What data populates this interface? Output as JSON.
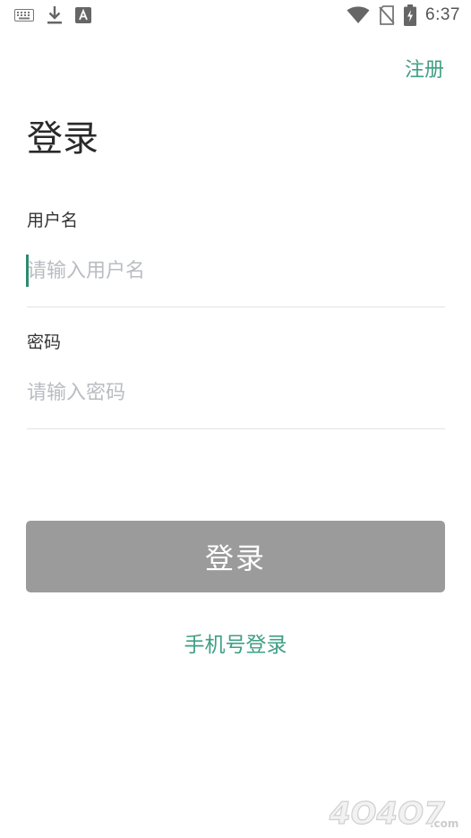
{
  "status_bar": {
    "time": "6:37",
    "left_icons": [
      "keyboard-icon",
      "download-icon",
      "text-a-icon"
    ],
    "right_icons": [
      "wifi-icon",
      "no-sim-icon",
      "battery-charging-icon"
    ]
  },
  "header": {
    "register_label": "注册"
  },
  "title": "登录",
  "username": {
    "label": "用户名",
    "placeholder": "请输入用户名",
    "value": ""
  },
  "password": {
    "label": "密码",
    "placeholder": "请输入密码",
    "value": ""
  },
  "login_button_label": "登录",
  "phone_login_label": "手机号登录",
  "watermark_text": "4O4O7.com",
  "colors": {
    "accent": "#3f9f84",
    "button_disabled": "#9b9b9b",
    "placeholder": "#b9bcc1",
    "divider": "#e3e3e3"
  }
}
